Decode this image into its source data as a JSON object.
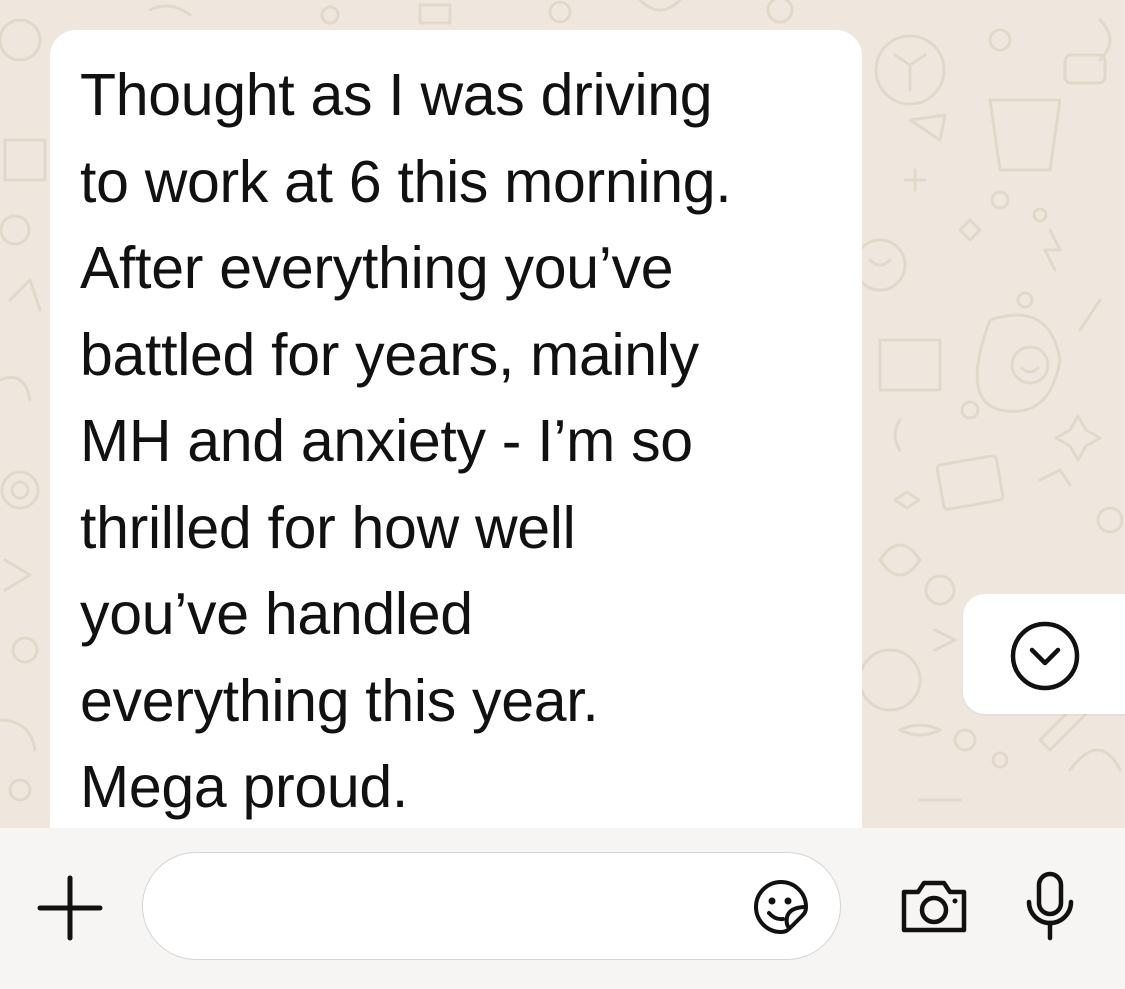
{
  "chat": {
    "message": {
      "lines": [
        "Thought as I was driving",
        "to work at 6 this morning.",
        "After everything you’ve",
        "battled for years, mainly",
        "MH and anxiety - I’m so",
        "thrilled for how well",
        "you’ve handled",
        "everything this year.",
        "Mega proud."
      ]
    },
    "scroll_button_icon": "chevron-down-circle-icon"
  },
  "composer": {
    "input_value": "",
    "input_placeholder": "",
    "icons": {
      "attach": "plus-icon",
      "sticker": "sticker-icon",
      "camera": "camera-icon",
      "microphone": "microphone-icon"
    }
  },
  "colors": {
    "wallpaper": "#efe7dd",
    "bubble": "#ffffff",
    "text": "#111111",
    "input_bar": "#f6f5f3"
  }
}
